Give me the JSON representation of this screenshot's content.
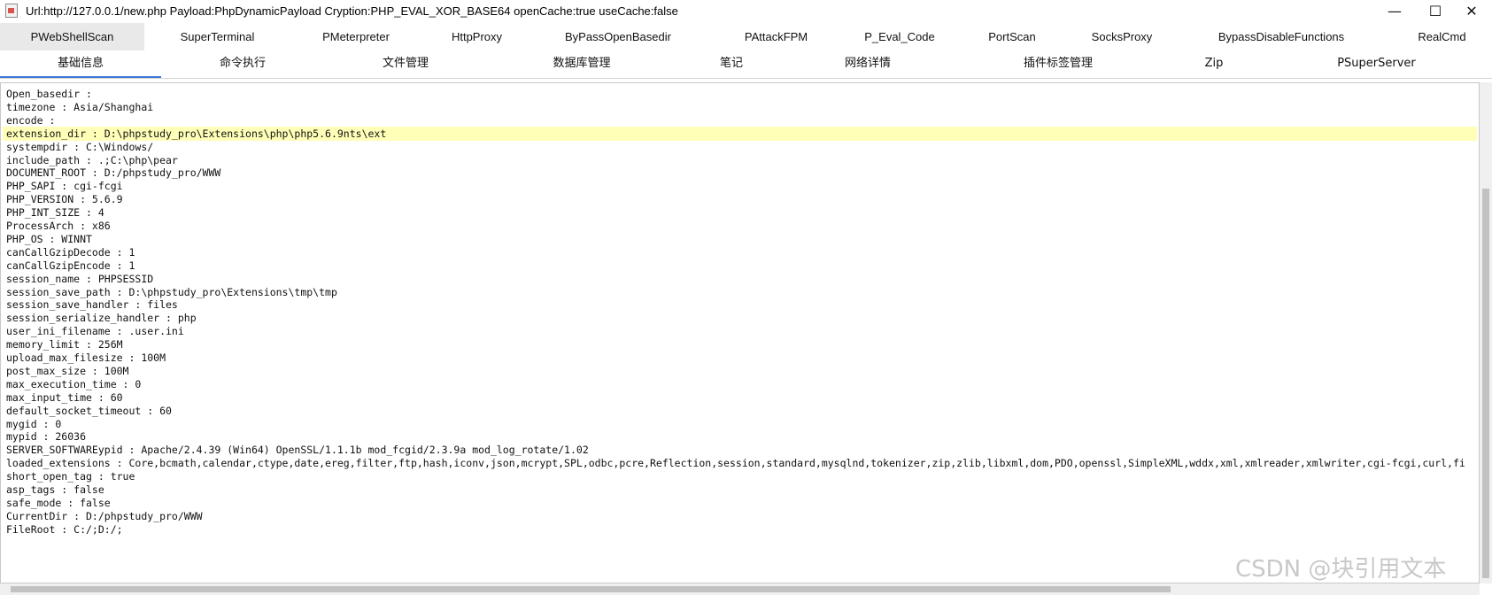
{
  "window": {
    "title": "Url:http://127.0.0.1/new.php Payload:PhpDynamicPayload Cryption:PHP_EVAL_XOR_BASE64 openCache:true useCache:false",
    "minimize_glyph": "—",
    "maximize_glyph": "☐",
    "close_glyph": "✕"
  },
  "plugin_tabs": [
    {
      "label": "PWebShellScan",
      "active": true
    },
    {
      "label": "SuperTerminal"
    },
    {
      "label": "PMeterpreter"
    },
    {
      "label": "HttpProxy"
    },
    {
      "label": "ByPassOpenBasedir"
    },
    {
      "label": "PAttackFPM"
    },
    {
      "label": "P_Eval_Code"
    },
    {
      "label": "PortScan"
    },
    {
      "label": "SocksProxy"
    },
    {
      "label": "BypassDisableFunctions"
    },
    {
      "label": "RealCmd"
    }
  ],
  "main_tabs": [
    {
      "label": "基础信息",
      "active": true
    },
    {
      "label": "命令执行"
    },
    {
      "label": "文件管理"
    },
    {
      "label": "数据库管理"
    },
    {
      "label": "笔记"
    },
    {
      "label": "网络详情"
    },
    {
      "label": "插件标签管理"
    },
    {
      "label": "Zip"
    },
    {
      "label": "PSuperServer"
    }
  ],
  "info_lines": [
    "Open_basedir :",
    "timezone : Asia/Shanghai",
    "encode :",
    "extension_dir : D:\\phpstudy_pro\\Extensions\\php\\php5.6.9nts\\ext",
    "systempdir : C:\\Windows/",
    "include_path : .;C:\\php\\pear",
    "DOCUMENT_ROOT : D:/phpstudy_pro/WWW",
    "PHP_SAPI : cgi-fcgi",
    "PHP_VERSION : 5.6.9",
    "PHP_INT_SIZE : 4",
    "ProcessArch : x86",
    "PHP_OS : WINNT",
    "canCallGzipDecode : 1",
    "canCallGzipEncode : 1",
    "session_name : PHPSESSID",
    "session_save_path : D:\\phpstudy_pro\\Extensions\\tmp\\tmp",
    "session_save_handler : files",
    "session_serialize_handler : php",
    "user_ini_filename : .user.ini",
    "memory_limit : 256M",
    "upload_max_filesize : 100M",
    "post_max_size : 100M",
    "max_execution_time : 0",
    "max_input_time : 60",
    "default_socket_timeout : 60",
    "mygid : 0",
    "mypid : 26036",
    "SERVER_SOFTWAREypid : Apache/2.4.39 (Win64) OpenSSL/1.1.1b mod_fcgid/2.3.9a mod_log_rotate/1.02",
    "loaded_extensions : Core,bcmath,calendar,ctype,date,ereg,filter,ftp,hash,iconv,json,mcrypt,SPL,odbc,pcre,Reflection,session,standard,mysqlnd,tokenizer,zip,zlib,libxml,dom,PDO,openssl,SimpleXML,wddx,xml,xmlreader,xmlwriter,cgi-fcgi,curl,fi",
    "short_open_tag : true",
    "asp_tags : false",
    "safe_mode : false",
    "CurrentDir : D:/phpstudy_pro/WWW",
    "FileRoot : C:/;D:/;"
  ],
  "highlighted_line_index": 3,
  "highlight_color": "#ffffb8",
  "watermark": "CSDN @块引用文本"
}
